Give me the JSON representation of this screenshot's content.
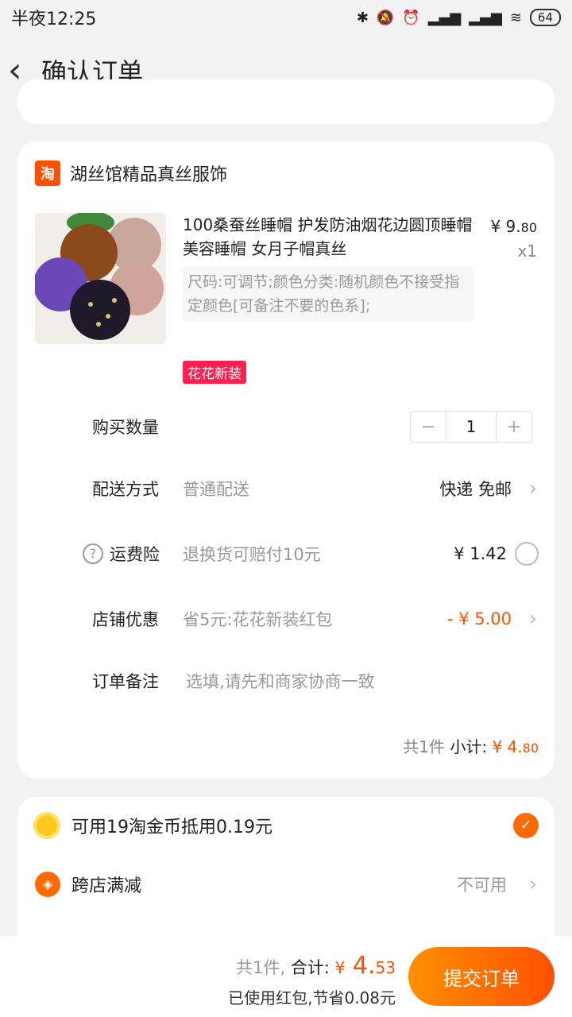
{
  "status_bar": {
    "time": "半夜12:25",
    "battery": "64"
  },
  "nav": {
    "title": "确认订单"
  },
  "shop": {
    "logo_text": "淘",
    "name": "湖丝馆精品真丝服饰"
  },
  "product": {
    "title": "100桑蚕丝睡帽 护发防油烟花边圆顶睡帽美容睡帽 女月子帽真丝",
    "price_symbol": "¥",
    "price_int": "9.",
    "price_dec": "80",
    "qty": "x1",
    "sku": "尺码:可调节;颜色分类:随机颜色不接受指定颜色[可备注不要的色系];",
    "tag": "花花新装"
  },
  "rows": {
    "quantity": {
      "label": "购买数量",
      "minus": "−",
      "value": "1",
      "plus": "+"
    },
    "delivery": {
      "label": "配送方式",
      "value": "普通配送",
      "right": "快递 免邮"
    },
    "insurance": {
      "label": "运费险",
      "value": "退换货可赔付10元",
      "right": "¥ 1.42"
    },
    "discount": {
      "label": "店铺优惠",
      "value": "省5元:花花新装红包",
      "right": "- ¥ 5.00"
    },
    "remark": {
      "label": "订单备注",
      "placeholder": "选填,请先和商家协商一致"
    }
  },
  "subtotal": {
    "count": "共1件",
    "label": "小计:",
    "symbol": "¥",
    "int": "4.",
    "dec": "80"
  },
  "payment": {
    "coins": {
      "text": "可用19淘金币抵用0.19元"
    },
    "cross_store": {
      "text": "跨店满减",
      "right": "不可用"
    }
  },
  "bottom": {
    "count": "共1件,",
    "label": "合计:",
    "symbol": "¥",
    "int": "4.",
    "dec": "53",
    "note": "已使用红包,节省0.08元",
    "submit": "提交订单"
  },
  "colors": {
    "accent": "#ff5000",
    "tag": "#ff2050",
    "background": "#f2f2f2"
  }
}
